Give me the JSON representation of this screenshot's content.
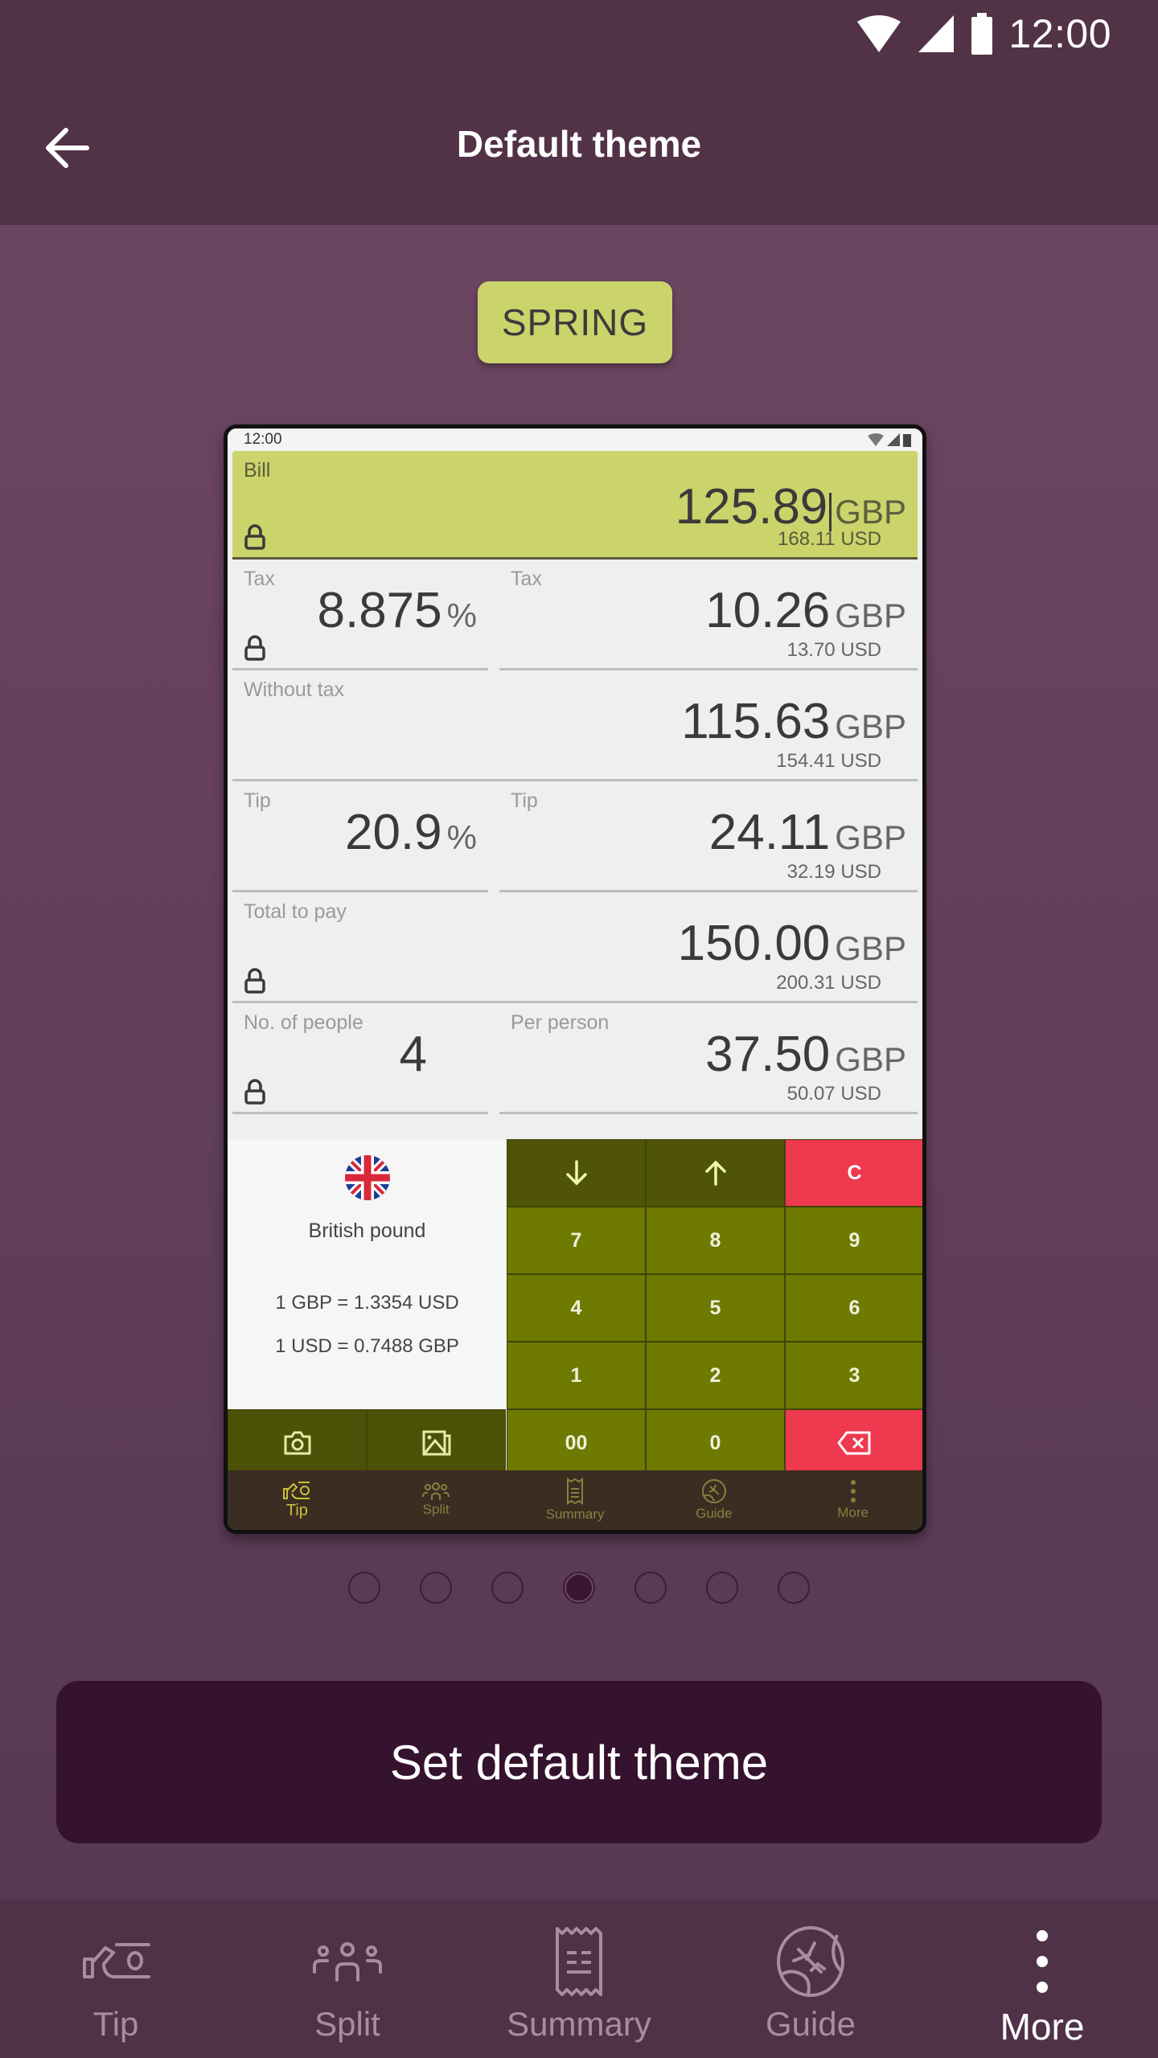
{
  "status_bar": {
    "time": "12:00",
    "icons": [
      "wifi-icon",
      "signal-icon",
      "battery-icon"
    ]
  },
  "app_bar": {
    "title": "Default theme",
    "back_icon": "arrow-left-icon"
  },
  "theme_chip": {
    "label": "SPRING",
    "color": "#cbd36b"
  },
  "preview": {
    "status_time": "12:00",
    "bill": {
      "label": "Bill",
      "value": "125.89",
      "currency": "GBP",
      "converted": "168.11 USD",
      "locked": true
    },
    "rows": [
      {
        "left": {
          "label": "Tax",
          "value": "8.875",
          "unit": "%",
          "locked": true
        },
        "right": {
          "label": "Tax",
          "value": "10.26",
          "currency": "GBP",
          "converted": "13.70 USD"
        }
      },
      {
        "full": {
          "label": "Without tax",
          "value": "115.63",
          "currency": "GBP",
          "converted": "154.41 USD"
        }
      },
      {
        "left": {
          "label": "Tip",
          "value": "20.9",
          "unit": "%",
          "locked": false
        },
        "right": {
          "label": "Tip",
          "value": "24.11",
          "currency": "GBP",
          "converted": "32.19 USD"
        }
      },
      {
        "full": {
          "label": "Total to pay",
          "value": "150.00",
          "currency": "GBP",
          "converted": "200.31 USD",
          "locked": true
        }
      },
      {
        "left": {
          "label": "No. of people",
          "value": "4",
          "locked": true
        },
        "right": {
          "label": "Per person",
          "value": "37.50",
          "currency": "GBP",
          "converted": "50.07 USD"
        }
      }
    ],
    "currency_panel": {
      "flag": "uk-flag-icon",
      "name": "British pound",
      "rate1": "1 GBP = 1.3354 USD",
      "rate2": "1 USD = 0.7488 GBP"
    },
    "keypad": {
      "down": "↓",
      "up": "↑",
      "clear": "C",
      "digits": [
        "7",
        "8",
        "9",
        "4",
        "5",
        "6",
        "1",
        "2",
        "3"
      ],
      "double_zero": "00",
      "zero": "0",
      "camera_icon": "camera-icon",
      "gallery_icon": "image-icon",
      "backspace_icon": "backspace-icon"
    },
    "nav": [
      {
        "label": "Tip",
        "active": true
      },
      {
        "label": "Split",
        "active": false
      },
      {
        "label": "Summary",
        "active": false
      },
      {
        "label": "Guide",
        "active": false
      },
      {
        "label": "More",
        "active": false
      }
    ]
  },
  "pager": {
    "count": 7,
    "active_index": 3
  },
  "primary_button": {
    "label": "Set default theme"
  },
  "bottom_nav": [
    {
      "label": "Tip",
      "icon": "tip-hand-icon",
      "active": false
    },
    {
      "label": "Split",
      "icon": "people-icon",
      "active": false
    },
    {
      "label": "Summary",
      "icon": "receipt-icon",
      "active": false
    },
    {
      "label": "Guide",
      "icon": "globe-plane-icon",
      "active": false
    },
    {
      "label": "More",
      "icon": "more-vert-icon",
      "active": true
    }
  ],
  "colors": {
    "topbar": "#513246",
    "background": "#6e4863",
    "primary_button": "#35122e",
    "keypad_olive": "#6f7a00",
    "keypad_dark": "#4f5408",
    "keypad_red": "#ef394f"
  }
}
